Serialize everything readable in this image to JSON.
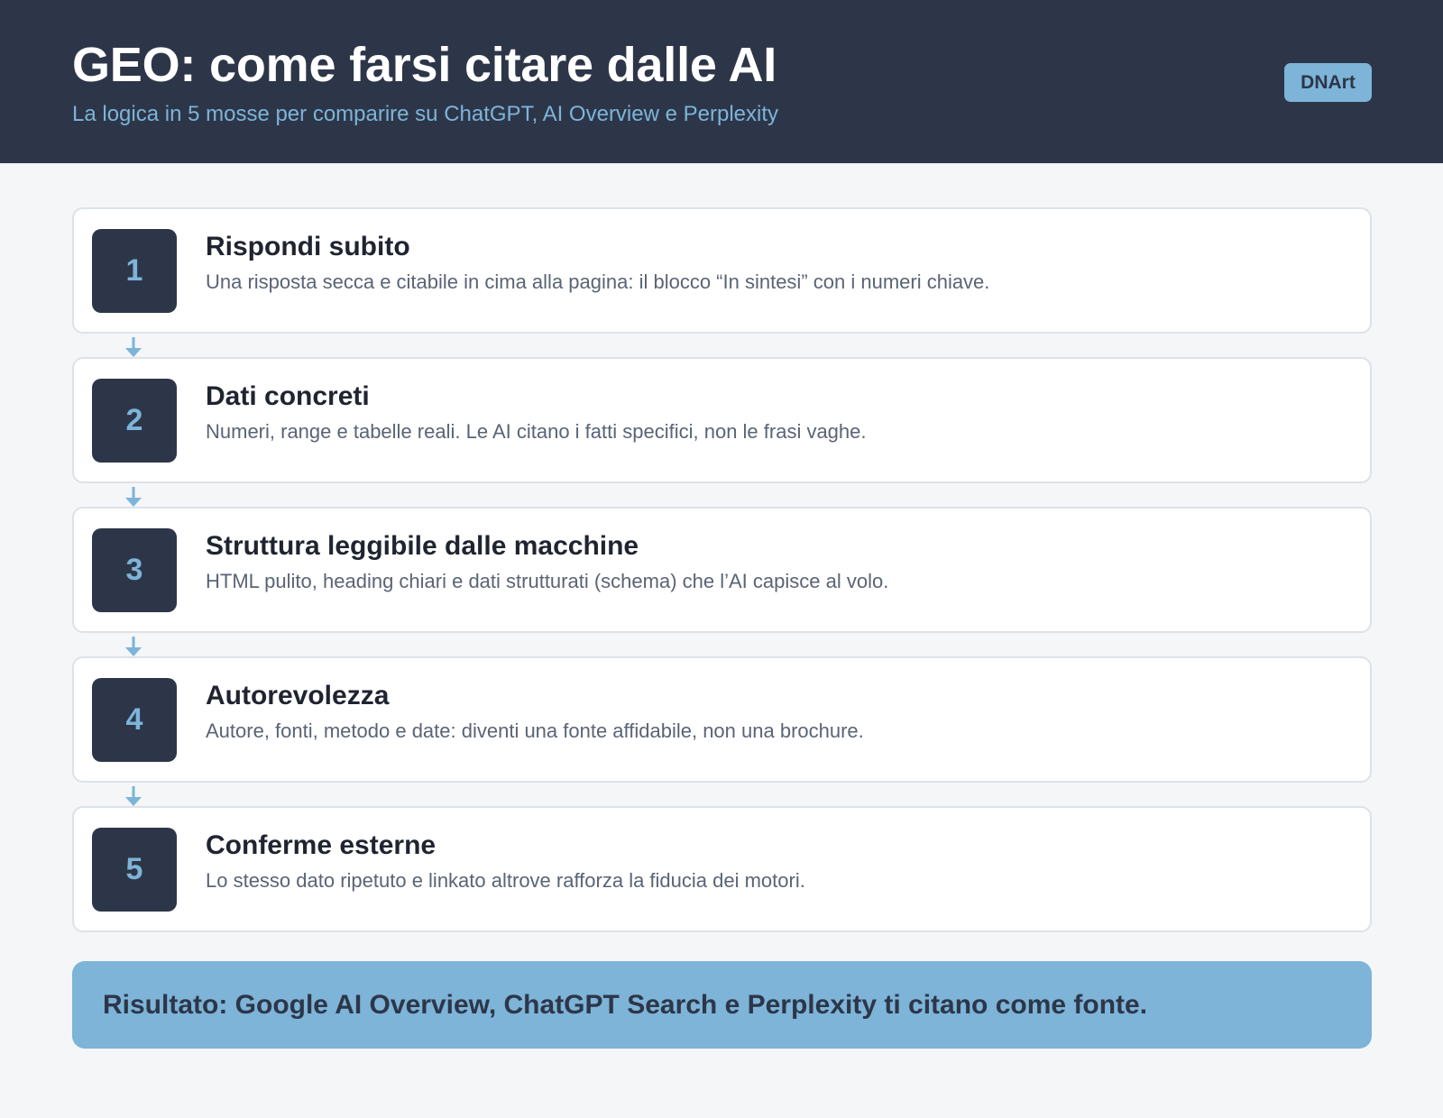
{
  "header": {
    "title": "GEO: come farsi citare dalle AI",
    "subtitle": "La logica in 5 mosse per comparire su ChatGPT, AI Overview e Perplexity",
    "brand": "DNArt"
  },
  "steps": [
    {
      "number": "1",
      "title": "Rispondi subito",
      "description": "Una risposta secca e citabile in cima alla pagina: il blocco “In sintesi” con i numeri chiave."
    },
    {
      "number": "2",
      "title": "Dati concreti",
      "description": "Numeri, range e tabelle reali. Le AI citano i fatti specifici, non le frasi vaghe."
    },
    {
      "number": "3",
      "title": "Struttura leggibile dalle macchine",
      "description": "HTML pulito, heading chiari e dati strutturati (schema) che l’AI capisce al volo."
    },
    {
      "number": "4",
      "title": "Autorevolezza",
      "description": "Autore, fonti, metodo e date: diventi una fonte affidabile, non una brochure."
    },
    {
      "number": "5",
      "title": "Conferme esterne",
      "description": "Lo stesso dato ripetuto e linkato altrove rafforza la fiducia dei motori."
    }
  ],
  "result": {
    "text": "Risultato: Google AI Overview, ChatGPT Search e Perplexity ti citano come fonte."
  },
  "colors": {
    "dark": "#2d3649",
    "accent": "#7db4d8",
    "background": "#f4f6f8",
    "card": "#ffffff"
  },
  "icons": {
    "connector": "arrow-down-icon"
  }
}
